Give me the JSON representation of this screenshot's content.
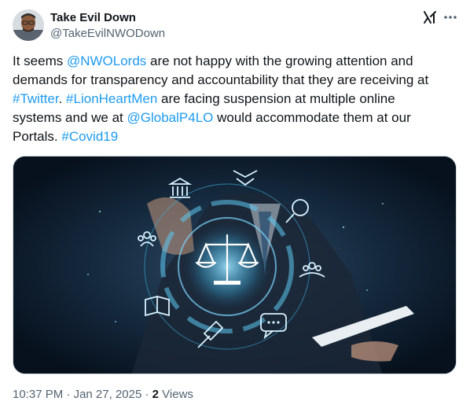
{
  "author": {
    "display_name": "Take Evil Down",
    "handle": "@TakeEvilNWODown"
  },
  "icons": {
    "grok": "grok-icon",
    "more": "more-dots-icon"
  },
  "tweet": {
    "line1_a": "It seems ",
    "line1_link": "@NWOLords",
    "line1_b": " are not happy with the growing attention and",
    "line2": "demands for transparency and accountability that they are receiving at",
    "line3_link1": "#Twitter",
    "line3_a": ". ",
    "line3_link2": "#LionHeartMen",
    "line3_b": " are facing suspension at multiple online",
    "line4_a": "systems and we at ",
    "line4_link": "@GlobalP4LO",
    "line4_b": " would accommodate them at our",
    "line5_a": "Portals. ",
    "line5_link": "#Covid19"
  },
  "meta": {
    "time": "10:37 PM",
    "sep1": " · ",
    "date": "Jan 27, 2025",
    "sep2": " · ",
    "views_count": "2",
    "views_label": " Views"
  },
  "colors": {
    "link": "#1d9bf0",
    "text": "#0f1419",
    "secondary": "#536471"
  }
}
